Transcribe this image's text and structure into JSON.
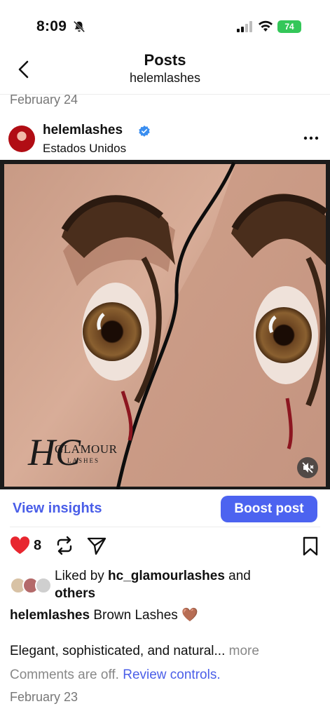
{
  "status_bar": {
    "time": "8:09",
    "battery": "74",
    "icons": [
      "bell-off-icon",
      "signal-icon",
      "wifi-icon",
      "battery-icon"
    ]
  },
  "header": {
    "title": "Posts",
    "subtitle": "helemlashes"
  },
  "previous_post": {
    "date": "February 24"
  },
  "post": {
    "author": "helemlashes",
    "location": "Estados Unidos",
    "actions": {
      "view_insights": "View insights",
      "boost": "Boost post",
      "like_count": "8"
    },
    "likes": {
      "prefix": "Liked by ",
      "user": "hc_glamourlashes",
      "middle": " and",
      "others": "others"
    },
    "caption": {
      "author": "helemlashes",
      "text": " Brown Lashes 🤎",
      "body": "Elegant, sophisticated, and natural... ",
      "more": "more"
    },
    "comments": {
      "off_text": "Comments are off. ",
      "review_link": "Review controls."
    }
  },
  "photo_watermark": {
    "monogram": "HC",
    "brand": "GLAMOUR",
    "sub": "LASHES"
  },
  "next_post": {
    "date": "February 23"
  },
  "colors": {
    "accent_link": "#4a5ee8",
    "boost_bg": "#4c63f0",
    "heart": "#e8262f",
    "battery": "#34c759"
  }
}
